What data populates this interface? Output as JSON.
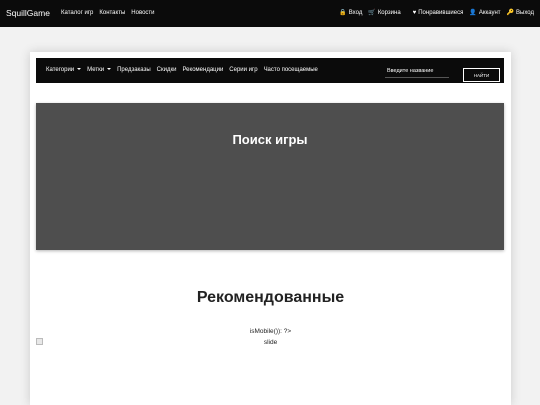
{
  "topbar": {
    "brand": "SquillGame",
    "nav": [
      "Каталог игр",
      "Контакты",
      "Новости"
    ],
    "right": [
      {
        "label": "Вход",
        "icon": "lock-icon",
        "glyph": "🔒"
      },
      {
        "label": "Корзина",
        "icon": "cart-icon",
        "glyph": "🛒"
      },
      {
        "label": "Понравившиеся",
        "icon": "heart-icon",
        "glyph": "♥"
      },
      {
        "label": "Аккаунт",
        "icon": "user-icon",
        "glyph": "👤"
      },
      {
        "label": "Выход",
        "icon": "key-icon",
        "glyph": "🔑"
      }
    ]
  },
  "catnav": {
    "items": [
      "Категории",
      "Метки",
      "Предзаказы",
      "Скидки",
      "Рекомендации",
      "Серии игр",
      "Часто посещаемые"
    ],
    "search_placeholder": "Введите название",
    "search_button": "НАЙТИ"
  },
  "hero": {
    "title": "Поиск игры"
  },
  "recommended": {
    "title": "Рекомендованные",
    "php_text": "isMobile()): ?>",
    "slide_alt": "slide"
  },
  "colors": {
    "dark": "#0b0b0b",
    "hero": "#4e4e4e",
    "background": "#f2f2f2"
  }
}
